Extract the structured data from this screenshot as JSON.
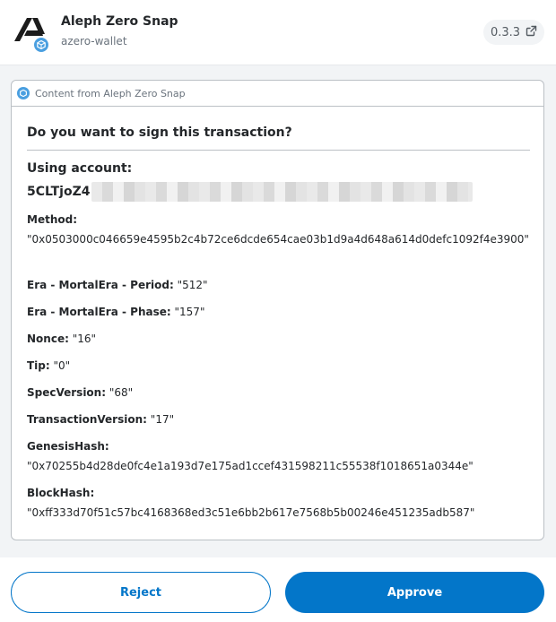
{
  "header": {
    "app_name": "Aleph Zero Snap",
    "app_id": "azero-wallet",
    "version": "0.3.3",
    "logo_icon": "aleph-zero-logo-icon",
    "badge_icon": "snap-cube-icon",
    "external_link_icon": "external-link-icon"
  },
  "card": {
    "source_label": "Content from Aleph Zero Snap",
    "title": "Do you want to sign this transaction?",
    "account_heading": "Using account:",
    "account_prefix": "5CLTjoZ4",
    "fields": [
      {
        "label": "Method",
        "value": "\"0x0503000c046659e4595b2c4b72ce6dcde654cae03b1d9a4d648a614d0defc1092f4e3900\""
      },
      {
        "label": "Era - MortalEra - Period",
        "value": "\"512\""
      },
      {
        "label": "Era - MortalEra - Phase",
        "value": "\"157\""
      },
      {
        "label": "Nonce",
        "value": "\"16\""
      },
      {
        "label": "Tip",
        "value": "\"0\""
      },
      {
        "label": "SpecVersion",
        "value": "\"68\""
      },
      {
        "label": "TransactionVersion",
        "value": "\"17\""
      },
      {
        "label": "GenesisHash",
        "value": "\"0x70255b4d28de0fc4e1a193d7e175ad1ccef431598211c55538f1018651a0344e\""
      },
      {
        "label": "BlockHash",
        "value": "\"0xff333d70f51c57bc4168368ed3c51e6bb2b617e7568b5b00246e451235adb587\""
      }
    ]
  },
  "footer": {
    "reject_label": "Reject",
    "approve_label": "Approve"
  },
  "colors": {
    "accent": "#0376c9",
    "badge": "#4a9fe0",
    "border": "#bbc0c5"
  }
}
